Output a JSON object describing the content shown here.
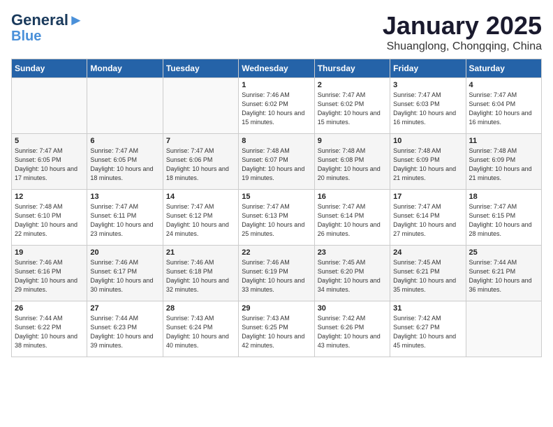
{
  "header": {
    "logo_general": "General",
    "logo_blue": "Blue",
    "title": "January 2025",
    "subtitle": "Shuanglong, Chongqing, China"
  },
  "weekdays": [
    "Sunday",
    "Monday",
    "Tuesday",
    "Wednesday",
    "Thursday",
    "Friday",
    "Saturday"
  ],
  "weeks": [
    [
      {
        "day": "",
        "info": ""
      },
      {
        "day": "",
        "info": ""
      },
      {
        "day": "",
        "info": ""
      },
      {
        "day": "1",
        "info": "Sunrise: 7:46 AM\nSunset: 6:02 PM\nDaylight: 10 hours and 15 minutes."
      },
      {
        "day": "2",
        "info": "Sunrise: 7:47 AM\nSunset: 6:02 PM\nDaylight: 10 hours and 15 minutes."
      },
      {
        "day": "3",
        "info": "Sunrise: 7:47 AM\nSunset: 6:03 PM\nDaylight: 10 hours and 16 minutes."
      },
      {
        "day": "4",
        "info": "Sunrise: 7:47 AM\nSunset: 6:04 PM\nDaylight: 10 hours and 16 minutes."
      }
    ],
    [
      {
        "day": "5",
        "info": "Sunrise: 7:47 AM\nSunset: 6:05 PM\nDaylight: 10 hours and 17 minutes."
      },
      {
        "day": "6",
        "info": "Sunrise: 7:47 AM\nSunset: 6:05 PM\nDaylight: 10 hours and 18 minutes."
      },
      {
        "day": "7",
        "info": "Sunrise: 7:47 AM\nSunset: 6:06 PM\nDaylight: 10 hours and 18 minutes."
      },
      {
        "day": "8",
        "info": "Sunrise: 7:48 AM\nSunset: 6:07 PM\nDaylight: 10 hours and 19 minutes."
      },
      {
        "day": "9",
        "info": "Sunrise: 7:48 AM\nSunset: 6:08 PM\nDaylight: 10 hours and 20 minutes."
      },
      {
        "day": "10",
        "info": "Sunrise: 7:48 AM\nSunset: 6:09 PM\nDaylight: 10 hours and 21 minutes."
      },
      {
        "day": "11",
        "info": "Sunrise: 7:48 AM\nSunset: 6:09 PM\nDaylight: 10 hours and 21 minutes."
      }
    ],
    [
      {
        "day": "12",
        "info": "Sunrise: 7:48 AM\nSunset: 6:10 PM\nDaylight: 10 hours and 22 minutes."
      },
      {
        "day": "13",
        "info": "Sunrise: 7:47 AM\nSunset: 6:11 PM\nDaylight: 10 hours and 23 minutes."
      },
      {
        "day": "14",
        "info": "Sunrise: 7:47 AM\nSunset: 6:12 PM\nDaylight: 10 hours and 24 minutes."
      },
      {
        "day": "15",
        "info": "Sunrise: 7:47 AM\nSunset: 6:13 PM\nDaylight: 10 hours and 25 minutes."
      },
      {
        "day": "16",
        "info": "Sunrise: 7:47 AM\nSunset: 6:14 PM\nDaylight: 10 hours and 26 minutes."
      },
      {
        "day": "17",
        "info": "Sunrise: 7:47 AM\nSunset: 6:14 PM\nDaylight: 10 hours and 27 minutes."
      },
      {
        "day": "18",
        "info": "Sunrise: 7:47 AM\nSunset: 6:15 PM\nDaylight: 10 hours and 28 minutes."
      }
    ],
    [
      {
        "day": "19",
        "info": "Sunrise: 7:46 AM\nSunset: 6:16 PM\nDaylight: 10 hours and 29 minutes."
      },
      {
        "day": "20",
        "info": "Sunrise: 7:46 AM\nSunset: 6:17 PM\nDaylight: 10 hours and 30 minutes."
      },
      {
        "day": "21",
        "info": "Sunrise: 7:46 AM\nSunset: 6:18 PM\nDaylight: 10 hours and 32 minutes."
      },
      {
        "day": "22",
        "info": "Sunrise: 7:46 AM\nSunset: 6:19 PM\nDaylight: 10 hours and 33 minutes."
      },
      {
        "day": "23",
        "info": "Sunrise: 7:45 AM\nSunset: 6:20 PM\nDaylight: 10 hours and 34 minutes."
      },
      {
        "day": "24",
        "info": "Sunrise: 7:45 AM\nSunset: 6:21 PM\nDaylight: 10 hours and 35 minutes."
      },
      {
        "day": "25",
        "info": "Sunrise: 7:44 AM\nSunset: 6:21 PM\nDaylight: 10 hours and 36 minutes."
      }
    ],
    [
      {
        "day": "26",
        "info": "Sunrise: 7:44 AM\nSunset: 6:22 PM\nDaylight: 10 hours and 38 minutes."
      },
      {
        "day": "27",
        "info": "Sunrise: 7:44 AM\nSunset: 6:23 PM\nDaylight: 10 hours and 39 minutes."
      },
      {
        "day": "28",
        "info": "Sunrise: 7:43 AM\nSunset: 6:24 PM\nDaylight: 10 hours and 40 minutes."
      },
      {
        "day": "29",
        "info": "Sunrise: 7:43 AM\nSunset: 6:25 PM\nDaylight: 10 hours and 42 minutes."
      },
      {
        "day": "30",
        "info": "Sunrise: 7:42 AM\nSunset: 6:26 PM\nDaylight: 10 hours and 43 minutes."
      },
      {
        "day": "31",
        "info": "Sunrise: 7:42 AM\nSunset: 6:27 PM\nDaylight: 10 hours and 45 minutes."
      },
      {
        "day": "",
        "info": ""
      }
    ]
  ]
}
